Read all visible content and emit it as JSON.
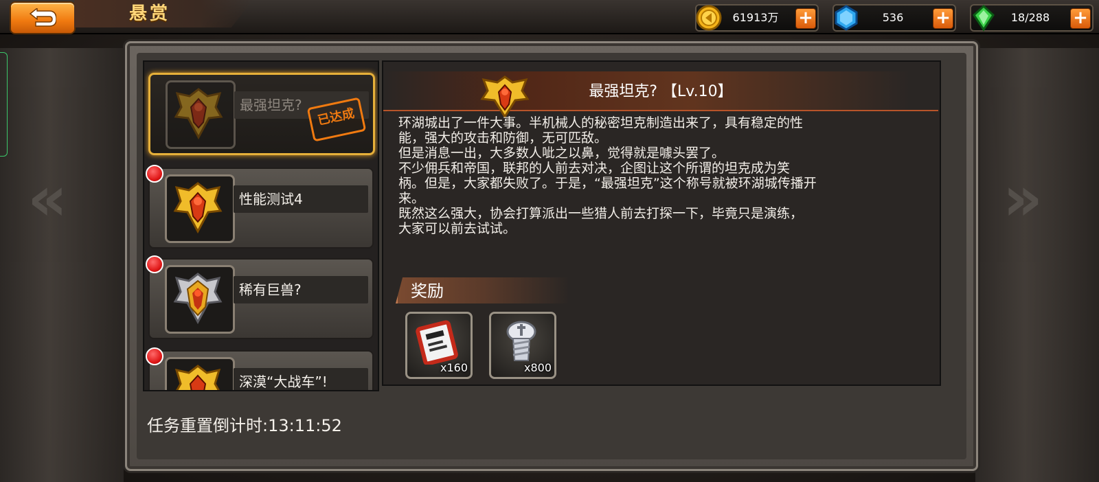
{
  "header": {
    "title": "悬赏"
  },
  "resources": [
    {
      "name": "gold",
      "icon": "gold-coin-icon",
      "value": "61913万",
      "color": "#f5b41a"
    },
    {
      "name": "diamond",
      "icon": "blue-gem-icon",
      "value": "536",
      "color": "#2fa8f0"
    },
    {
      "name": "energy",
      "icon": "green-crystal-icon",
      "value": "18/288",
      "color": "#3cd24a"
    }
  ],
  "tasks": [
    {
      "name": "最强坦克?",
      "selected": true,
      "completed": true,
      "has_alert": false,
      "stamp": "已达成"
    },
    {
      "name": "性能测试4",
      "selected": false,
      "completed": false,
      "has_alert": true
    },
    {
      "name": "稀有巨兽?",
      "selected": false,
      "completed": false,
      "has_alert": true
    },
    {
      "name": "深漠“大战车”!",
      "selected": false,
      "completed": false,
      "has_alert": true
    }
  ],
  "detail": {
    "title": "最强坦克? 【Lv.10】",
    "description": "环湖城出了一件大事。半机械人的秘密坦克制造出来了，具有稳定的性\n能，强大的攻击和防御，无可匹敌。\n但是消息一出，大多数人呲之以鼻，觉得就是噱头罢了。\n不少佣兵和帝国，联邦的人前去对决，企图让这个所谓的坦克成为笑\n柄。但是，大家都失败了。于是，“最强坦克”这个称号就被环湖城传播开\n来。\n既然这么强大，协会打算派出一些猎人前去打探一下，毕竟只是演练，\n大家可以前去试试。",
    "reward_title": "奖励",
    "rewards": [
      {
        "icon": "ticket-scroll-icon",
        "qty": "x160"
      },
      {
        "icon": "screw-bolt-icon",
        "qty": "x800"
      }
    ]
  },
  "footer": {
    "countdown": "任务重置倒计时:13:11:52"
  },
  "colors": {
    "accent": "#f07a10",
    "gold_text": "#ffd77a",
    "selected_border": "#e6b03a"
  }
}
